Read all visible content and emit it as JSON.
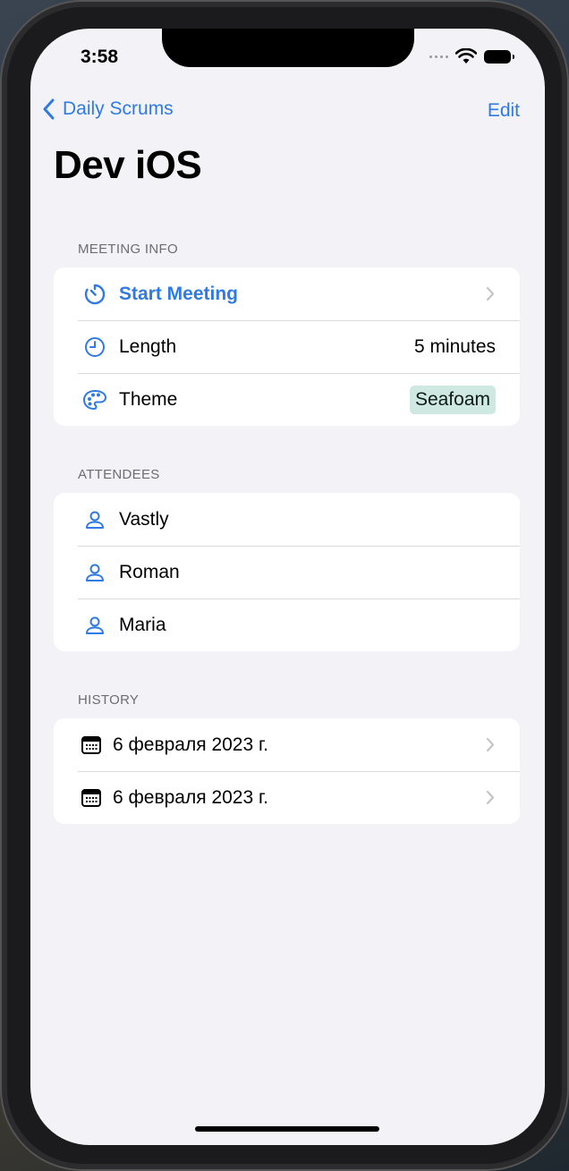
{
  "status": {
    "time": "3:58"
  },
  "nav": {
    "back_label": "Daily Scrums",
    "edit_label": "Edit"
  },
  "page": {
    "title": "Dev iOS"
  },
  "meeting_info": {
    "header": "MEETING INFO",
    "start_label": "Start Meeting",
    "length_label": "Length",
    "length_value": "5 minutes",
    "theme_label": "Theme",
    "theme_value": "Seafoam",
    "theme_color": "#cfe9e2"
  },
  "attendees": {
    "header": "ATTENDEES",
    "items": [
      "Vastly",
      "Roman",
      "Maria"
    ]
  },
  "history": {
    "header": "HISTORY",
    "items": [
      "6 февраля 2023 г.",
      "6 февраля 2023 г."
    ]
  },
  "colors": {
    "accent": "#2f7be3",
    "background": "#f2f2f7"
  },
  "icons": [
    "chevron-left-icon",
    "timer-icon",
    "clock-icon",
    "palette-icon",
    "person-icon",
    "calendar-icon",
    "chevron-right-icon",
    "wifi-icon",
    "battery-icon",
    "cellular-icon"
  ]
}
